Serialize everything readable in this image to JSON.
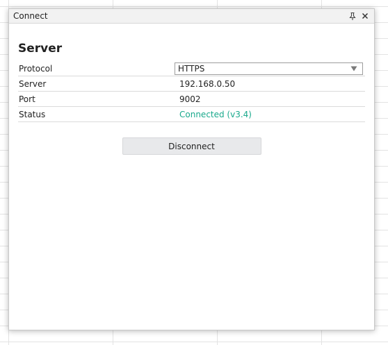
{
  "dialog": {
    "title": "Connect",
    "pin_icon": "pin-icon",
    "close_icon": "close-icon"
  },
  "section": {
    "heading": "Server"
  },
  "rows": {
    "protocol": {
      "label": "Protocol",
      "value": "HTTPS",
      "icon": "chevron-down-icon"
    },
    "server": {
      "label": "Server",
      "value": "192.168.0.50"
    },
    "port": {
      "label": "Port",
      "value": "9002"
    },
    "status": {
      "label": "Status",
      "value": "Connected (v3.4)",
      "color": "#19a98c"
    }
  },
  "actions": {
    "disconnect_label": "Disconnect"
  }
}
